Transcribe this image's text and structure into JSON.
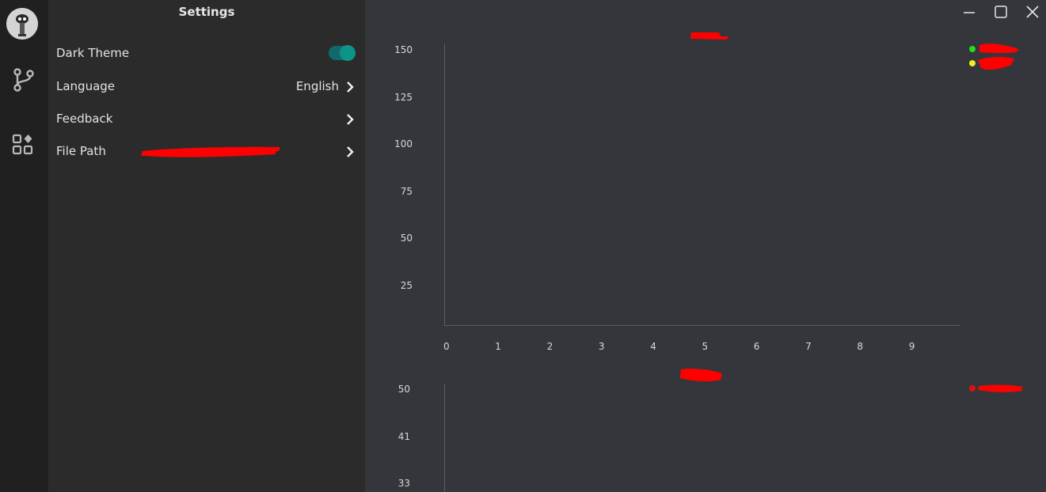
{
  "panel": {
    "title": "Settings",
    "dark_theme_label": "Dark Theme",
    "dark_theme_on": true,
    "language_label": "Language",
    "language_value": "English",
    "feedback_label": "Feedback",
    "file_path_label": "File Path"
  },
  "rail": {
    "icons": [
      "avatar",
      "git-branch-icon",
      "apps-icon"
    ]
  },
  "window": {
    "controls": [
      "minimize-icon",
      "maximize-icon",
      "close-icon"
    ]
  },
  "colors": {
    "accent": "#0d9488",
    "legend_green": "#22dd22",
    "legend_yellow": "#eeee22",
    "legend_red": "#dd1111",
    "redaction": "#ff0000"
  },
  "chart_data": [
    {
      "type": "line",
      "x_ticks": [
        "0",
        "1",
        "2",
        "3",
        "4",
        "5",
        "6",
        "7",
        "8",
        "9"
      ],
      "y_ticks": [
        "150",
        "125",
        "100",
        "75",
        "50",
        "25"
      ],
      "series": []
    },
    {
      "type": "line",
      "y_ticks": [
        "50",
        "41",
        "33"
      ],
      "series": []
    }
  ]
}
